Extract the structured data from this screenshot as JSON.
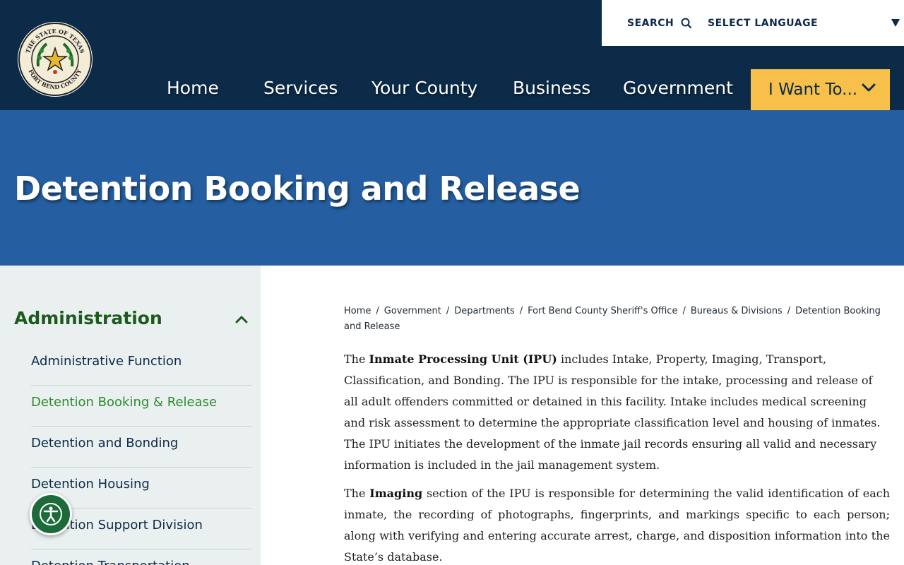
{
  "header": {
    "seal": {
      "top_text": "THE STATE OF TEXAS",
      "bottom_text": "FORT BEND COUNTY",
      "color_ring": "#1d6a2e",
      "color_fill": "#f3ecd6"
    },
    "utility": {
      "search_label": "SEARCH",
      "language_label": "SELECT LANGUAGE"
    },
    "nav": [
      {
        "label": "Home"
      },
      {
        "label": "Services"
      },
      {
        "label": "Your County"
      },
      {
        "label": "Business"
      },
      {
        "label": "Government"
      }
    ],
    "cta_label": "I Want To..."
  },
  "hero": {
    "title": "Detention Booking and Release"
  },
  "sidebar": {
    "title": "Administration",
    "items": [
      {
        "label": "Administrative Function",
        "active": false
      },
      {
        "label": "Detention Booking & Release",
        "active": true
      },
      {
        "label": "Detention and Bonding",
        "active": false
      },
      {
        "label": "Detention Housing",
        "active": false
      },
      {
        "label": "Detention Support Division",
        "active": false
      },
      {
        "label": "Detention Transportation",
        "active": false
      }
    ]
  },
  "breadcrumb": [
    "Home",
    "Government",
    "Departments",
    "Fort Bend County Sheriff's Office",
    "Bureaus & Divisions",
    "Detention Booking and Release"
  ],
  "content": {
    "p1_lead": "The ",
    "p1_bold": "Inmate Processing Unit (IPU)",
    "p1_rest": " includes Intake, Property, Imaging, Transport, Classification, and Bonding. The IPU is responsible for the intake, processing and release of all adult offenders committed or detained in this facility. Intake includes medical screening and risk assessment to determine the appropriate classification level and housing of inmates. The IPU initiates the development of the inmate jail records ensuring all valid and necessary information is included in the jail management system.",
    "p2_lead": "The ",
    "p2_bold": "Imaging",
    "p2_rest": " section of the IPU is responsible for determining the valid identification of each inmate, the recording of photographs, fingerprints, and markings specific to each person; along with verifying and entering accurate arrest, charge, and disposition information into the State’s database."
  },
  "colors": {
    "header_bg": "#0b2b48",
    "hero_bg": "#255fa1",
    "cta_bg": "#f6c04a",
    "sidebar_bg": "#eaf0f0",
    "sidebar_title": "#1e5a1e",
    "active_link": "#2e8b2e",
    "a11y_bg": "#1e6b3a"
  }
}
